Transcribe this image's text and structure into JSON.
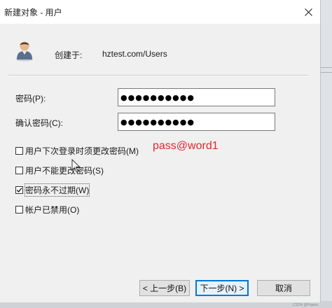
{
  "window": {
    "title": "新建对象 - 用户"
  },
  "header": {
    "create_label": "创建于:",
    "create_path": "hztest.com/Users"
  },
  "form": {
    "password_label": "密码(P):",
    "password_value": "●●●●●●●●●●",
    "confirm_label": "确认密码(C):",
    "confirm_value": "●●●●●●●●●●"
  },
  "options": [
    {
      "label": "用户下次登录时须更改密码(M)",
      "checked": false
    },
    {
      "label": "用户不能更改密码(S)",
      "checked": false
    },
    {
      "label": "密码永不过期(W)",
      "checked": true
    },
    {
      "label": "帐户已禁用(O)",
      "checked": false
    }
  ],
  "annotation": "pass@word1",
  "buttons": {
    "back": "< 上一步(B)",
    "next": "下一步(N) >",
    "cancel": "取消"
  },
  "watermark": "CSDN @Pojeris",
  "colors": {
    "annotation": "#e0282d",
    "default_button_border": "#0078d7"
  }
}
